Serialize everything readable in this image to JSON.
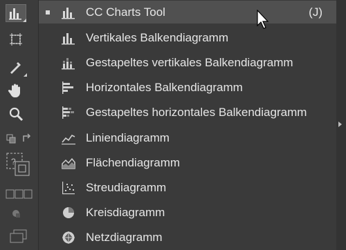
{
  "menu": {
    "items": [
      {
        "label": "CC Charts Tool",
        "shortcut": "(J)",
        "icon": "vertical-bar-chart-icon",
        "selected": true
      },
      {
        "label": "Vertikales Balkendiagramm",
        "icon": "vertical-bar-chart-icon"
      },
      {
        "label": "Gestapeltes vertikales Balkendiagramm",
        "icon": "stacked-vertical-bar-chart-icon"
      },
      {
        "label": "Horizontales Balkendiagramm",
        "icon": "horizontal-bar-chart-icon"
      },
      {
        "label": "Gestapeltes horizontales Balkendiagramm",
        "icon": "stacked-horizontal-bar-chart-icon"
      },
      {
        "label": "Liniendiagramm",
        "icon": "line-chart-icon"
      },
      {
        "label": "Flächendiagramm",
        "icon": "area-chart-icon"
      },
      {
        "label": "Streudiagramm",
        "icon": "scatter-chart-icon"
      },
      {
        "label": "Kreisdiagramm",
        "icon": "pie-chart-icon"
      },
      {
        "label": "Netzdiagramm",
        "icon": "radar-chart-icon"
      }
    ]
  },
  "toolbar": {
    "tools": [
      "chart-tool-icon",
      "artboard-icon",
      "eyedropper-icon",
      "hand-icon",
      "zoom-icon",
      "swap-fill-stroke-icon",
      "fill-stroke-icon",
      "screen-mode-icon",
      "draw-mode-icon",
      "change-screen-mode-icon"
    ]
  },
  "colors": {
    "panel_bg": "#3a3a3a",
    "selected_bg": "#505050",
    "text": "#e6e6e6"
  }
}
